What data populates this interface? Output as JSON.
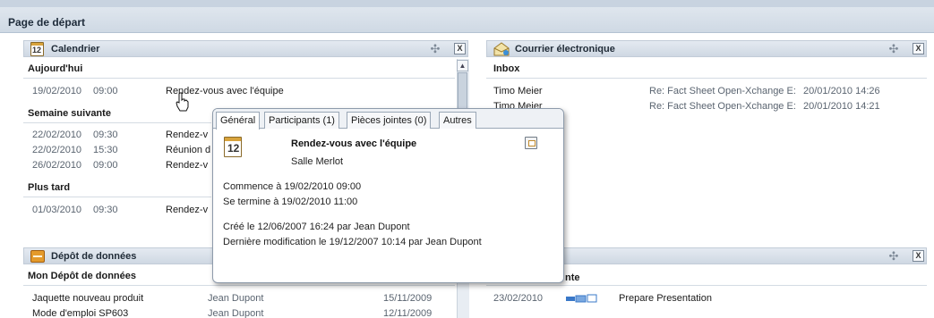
{
  "page": {
    "title": "Page de départ"
  },
  "calendar": {
    "title": "Calendrier",
    "icon_day": "12",
    "sections": {
      "today": "Aujourd'hui",
      "next_week": "Semaine suivante",
      "later": "Plus tard"
    },
    "today_rows": [
      {
        "date": "19/02/2010",
        "time": "09:00",
        "title": "Rendez-vous avec l'équipe"
      }
    ],
    "next_week_rows": [
      {
        "date": "22/02/2010",
        "time": "09:30",
        "title": "Rendez-v"
      },
      {
        "date": "22/02/2010",
        "time": "15:30",
        "title": "Réunion d"
      },
      {
        "date": "26/02/2010",
        "time": "09:00",
        "title": "Rendez-v"
      }
    ],
    "later_rows": [
      {
        "date": "01/03/2010",
        "time": "09:30",
        "title": "Rendez-v"
      }
    ],
    "close_label": "X",
    "move_icon": "move-icon"
  },
  "mail": {
    "title": "Courrier électronique",
    "folder": "Inbox",
    "rows": [
      {
        "from": "Timo Meier",
        "subject": "Re: Fact Sheet Open-Xchange E:",
        "date": "20/01/2010 14:26"
      },
      {
        "from": "Timo Meier",
        "subject": "Re: Fact Sheet Open-Xchange E:",
        "date": "20/01/2010 14:21"
      }
    ],
    "close_label": "X"
  },
  "storage": {
    "title": "Dépôt de données",
    "section": "Mon Dépôt de données",
    "rows": [
      {
        "name": "Jaquette nouveau produit",
        "owner": "Jean Dupont",
        "date": "15/11/2009"
      },
      {
        "name": "Mode d'emploi SP603",
        "owner": "Jean Dupont",
        "date": "12/11/2009"
      }
    ]
  },
  "tasks": {
    "section": "nte",
    "rows": [
      {
        "date": "23/02/2010",
        "title": "Prepare Presentation"
      }
    ],
    "close_label": "X"
  },
  "popup": {
    "tabs": [
      {
        "label": "Général"
      },
      {
        "label": "Participants (1)"
      },
      {
        "label": "Pièces jointes (0)"
      },
      {
        "label": "Autres"
      }
    ],
    "icon_day": "12",
    "title": "Rendez-vous avec l'équipe",
    "location": "Salle Merlot",
    "starts": "Commence à 19/02/2010 09:00",
    "ends": "Se termine à  19/02/2010 11:00",
    "created": "Créé le 12/06/2007 16:24 par Jean Dupont",
    "modified": "Dernière modification le 19/12/2007 10:14 par Jean Dupont"
  },
  "colors": {
    "header_bg": "#cfd9e4",
    "panel_header_bg": "#dce3ec",
    "accent_orange": "#e49a2b",
    "task_blue": "#3a78c8"
  }
}
